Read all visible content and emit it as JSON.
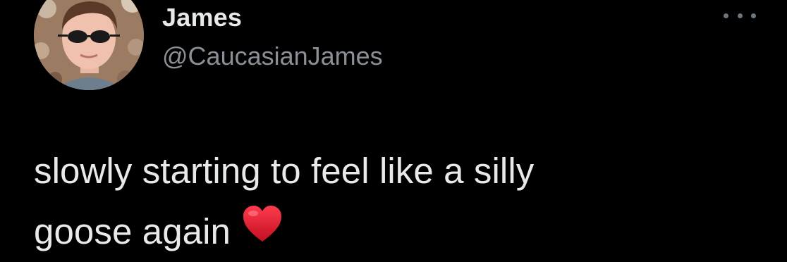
{
  "tweet": {
    "author": {
      "display_name": "James",
      "handle": "@CaucasianJames",
      "avatar_icon": "profile-photo"
    },
    "more_icon": "more-options-icon",
    "text_line1": "slowly starting to feel like a silly",
    "text_line2": "goose again",
    "emoji": "red-heart-emoji"
  },
  "colors": {
    "background": "#000000",
    "primary_text": "#e7e9ea",
    "secondary_text": "#8b9096",
    "heart": "#e0182d"
  }
}
